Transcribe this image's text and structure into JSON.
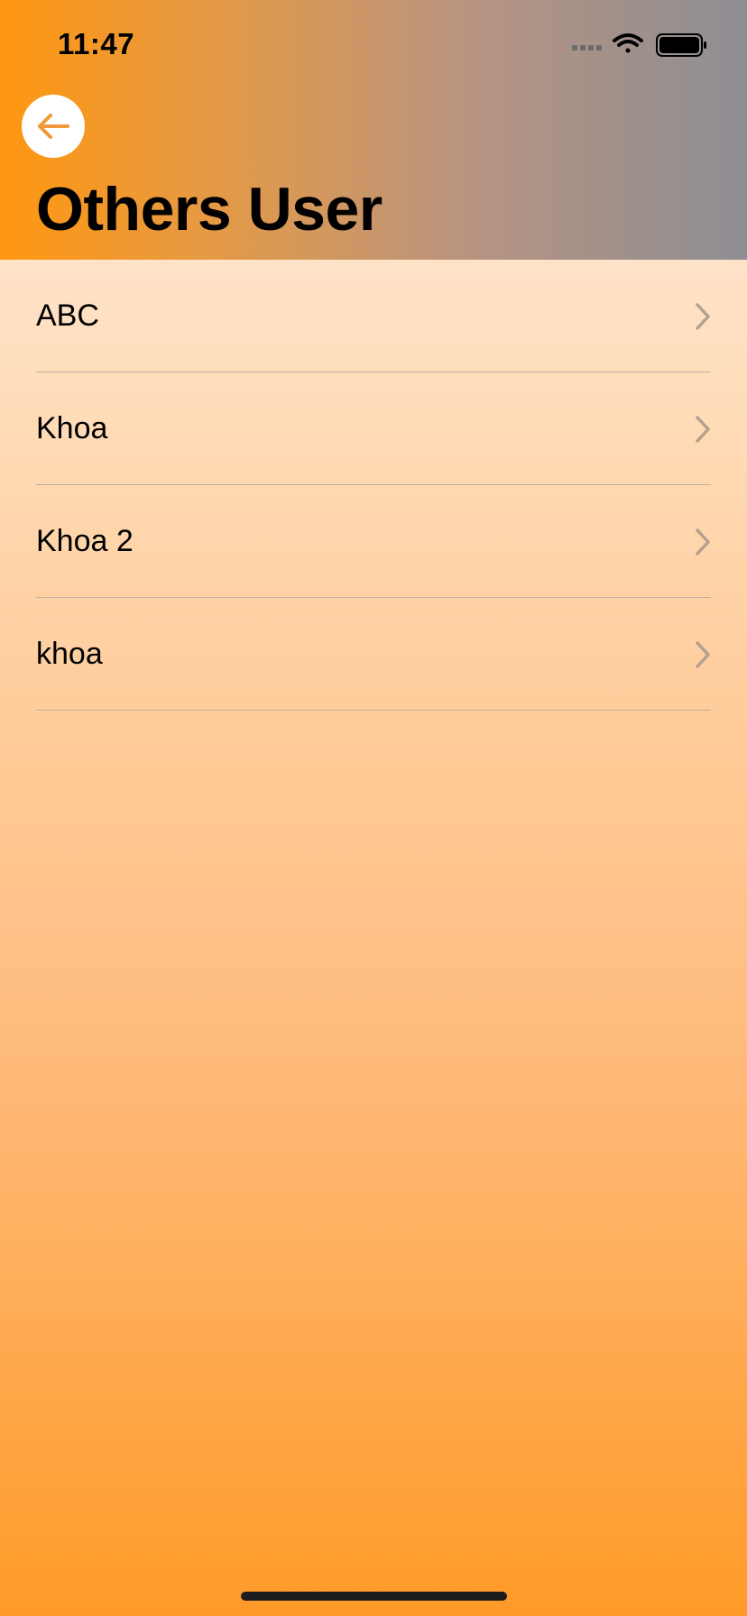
{
  "status_bar": {
    "time": "11:47",
    "icons": [
      "cellular-signal-icon",
      "wifi-icon",
      "battery-icon"
    ]
  },
  "header": {
    "back_icon": "arrow-left-icon",
    "title": "Others User"
  },
  "users": [
    {
      "name": "ABC"
    },
    {
      "name": "Khoa"
    },
    {
      "name": "Khoa 2"
    },
    {
      "name": "khoa"
    }
  ],
  "colors": {
    "accent": "#F0983A",
    "header_gradient_start": "#FF9710",
    "header_gradient_end": "#8E8E93",
    "background_top": "#FFF0E4",
    "background_bottom": "#FF9A28",
    "chevron": "#B4A08E",
    "divider": "#BDAF9F"
  }
}
